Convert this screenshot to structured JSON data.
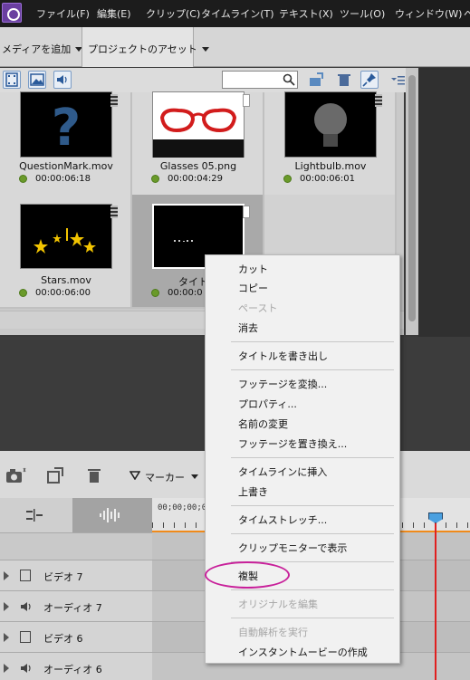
{
  "menubar": {
    "items": [
      "ファイル(F)",
      "編集(E)",
      "クリップ(C)",
      "タイムライン(T)",
      "テキスト(X)",
      "ツール(O)",
      "ウィンドウ(W)",
      "ヘ"
    ]
  },
  "toolbar": {
    "add_media": "メディアを追加",
    "project_assets": "プロジェクトのアセット"
  },
  "assets": [
    {
      "name": "QuestionMark.mov",
      "duration": "00:00:06:18"
    },
    {
      "name": "Glasses 05.png",
      "duration": "00:00:04:29"
    },
    {
      "name": "Lightbulb.mov",
      "duration": "00:00:06:01"
    },
    {
      "name": "Stars.mov",
      "duration": "00:00:06:00"
    },
    {
      "name": "タイトル",
      "duration": "00:00:0"
    }
  ],
  "timeline": {
    "marker_label": "マーカー",
    "timecode": "00;00;00;00",
    "timecode2": "00;00;00;00",
    "tracks": [
      {
        "label": "ビデオ 7",
        "type": "video"
      },
      {
        "label": "オーディオ 7",
        "type": "audio"
      },
      {
        "label": "ビデオ 6",
        "type": "video"
      },
      {
        "label": "オーディオ 6",
        "type": "audio"
      }
    ]
  },
  "context_menu": {
    "cut": "カット",
    "copy": "コピー",
    "paste": "ペースト",
    "clear": "消去",
    "export_title": "タイトルを書き出し",
    "interpret_footage": "フッテージを変換...",
    "properties": "プロパティ...",
    "rename": "名前の変更",
    "replace_footage": "フッテージを置き換え...",
    "insert_timeline": "タイムラインに挿入",
    "overwrite": "上書き",
    "time_stretch": "タイムストレッチ...",
    "show_clip_monitor": "クリップモニターで表示",
    "duplicate": "複製",
    "edit_original": "オリジナルを編集",
    "auto_analyze": "自動解析を実行",
    "create_instant_movie": "インスタントムービーの作成"
  },
  "colors": {
    "highlight_circle": "#c8209a",
    "playhead": "#e02020",
    "status_dot": "#6a9a2a"
  }
}
